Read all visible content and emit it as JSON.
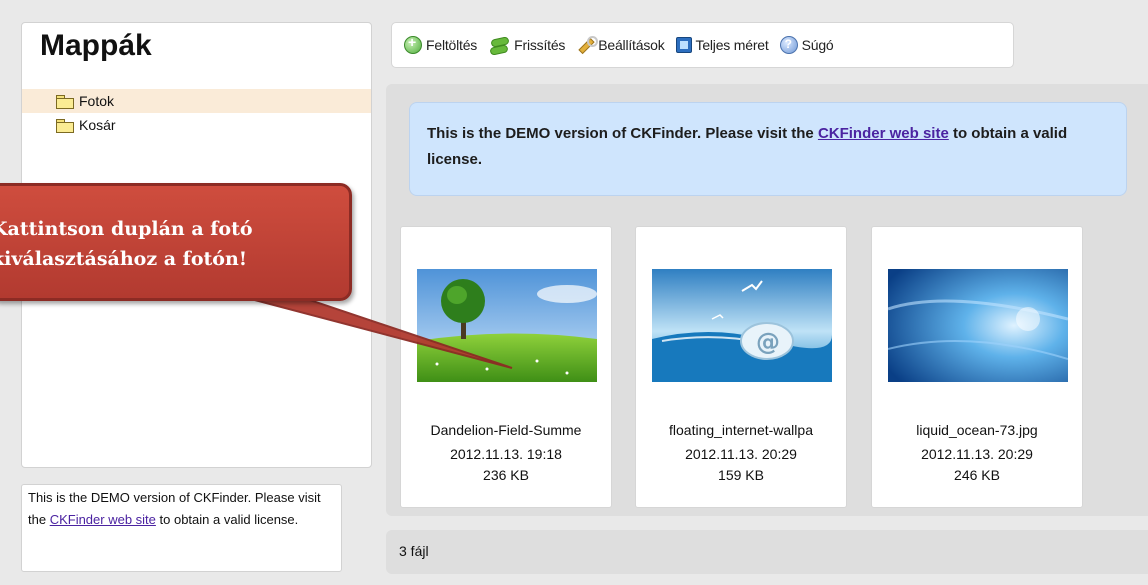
{
  "sidebar": {
    "title": "Mappák",
    "folders": [
      {
        "label": "Fotok",
        "selected": true
      },
      {
        "label": "Kosár",
        "selected": false
      }
    ],
    "demo": {
      "text_before": "This is the DEMO version of CKFinder. Please visit the ",
      "link": "CKFinder web site",
      "text_after": " to obtain a valid license."
    }
  },
  "toolbar": {
    "buttons": [
      {
        "label": "Feltöltés",
        "icon": "upload-icon"
      },
      {
        "label": "Frissítés",
        "icon": "refresh-icon"
      },
      {
        "label": "Beállítások",
        "icon": "settings-icon"
      },
      {
        "label": "Teljes méret",
        "icon": "fullscreen-icon"
      },
      {
        "label": "Súgó",
        "icon": "help-icon"
      }
    ]
  },
  "banner": {
    "text_before": "This is the DEMO version of CKFinder. Please visit the ",
    "link": "CKFinder web site",
    "text_after": " to obtain a valid license."
  },
  "files": [
    {
      "name": "Dandelion-Field-Summe",
      "date": "2012.11.13. 19:18",
      "size": "236 KB"
    },
    {
      "name": "floating_internet-wallpa",
      "date": "2012.11.13. 20:29",
      "size": "159 KB"
    },
    {
      "name": "liquid_ocean-73.jpg",
      "date": "2012.11.13. 20:29",
      "size": "246 KB"
    }
  ],
  "status": {
    "file_count": "3 fájl"
  },
  "callout": {
    "line1": "Kattintson duplán a fotó",
    "line2": "kiválasztásához a fotón!"
  },
  "colors": {
    "accent": "#cf4d3e",
    "banner_bg": "#cfe5fd",
    "link": "#4b23a1",
    "selected_folder": "#faebd8"
  }
}
